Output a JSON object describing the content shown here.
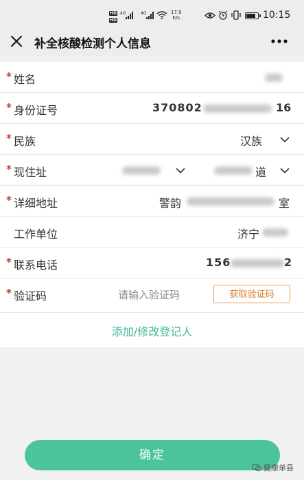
{
  "status_bar": {
    "network_hd_1": "HD",
    "network_hd_2": "HD",
    "sig_label_1": "4G",
    "sig_label_2": "4G",
    "speed_value": "17.9",
    "speed_unit": "K/s",
    "time": "10:15",
    "icons": [
      "eye-icon",
      "alarm-icon",
      "vibrate-icon",
      "battery-icon"
    ]
  },
  "header": {
    "title": "补全核酸检测个人信息",
    "close_icon": "close-icon",
    "more_icon": "more-icon"
  },
  "form": {
    "name": {
      "label": "姓名",
      "required": "*"
    },
    "id_number": {
      "label": "身份证号",
      "required": "*",
      "value_prefix": "370802",
      "value_suffix": "16"
    },
    "ethnicity": {
      "label": "民族",
      "required": "*",
      "value": "汉族"
    },
    "address": {
      "label": "现住址",
      "required": "*",
      "street_suffix": "道"
    },
    "detail_address": {
      "label": "详细地址",
      "required": "*",
      "value_prefix": "警韵",
      "value_suffix": "室"
    },
    "work_unit": {
      "label": "工作单位",
      "value_prefix": "济宁"
    },
    "phone": {
      "label": "联系电话",
      "required": "*",
      "value_prefix": "156",
      "value_suffix": "2"
    },
    "verify_code": {
      "label": "验证码",
      "required": "*",
      "placeholder": "请输入验证码",
      "button": "获取验证码"
    }
  },
  "add_link": "添加/修改登记人",
  "confirm_button": "确定",
  "watermark": "健康单县",
  "colors": {
    "accent": "#4cc59d",
    "link": "#3cb79a",
    "code_button": "#d87a2c",
    "required_star": "#c0392b"
  }
}
